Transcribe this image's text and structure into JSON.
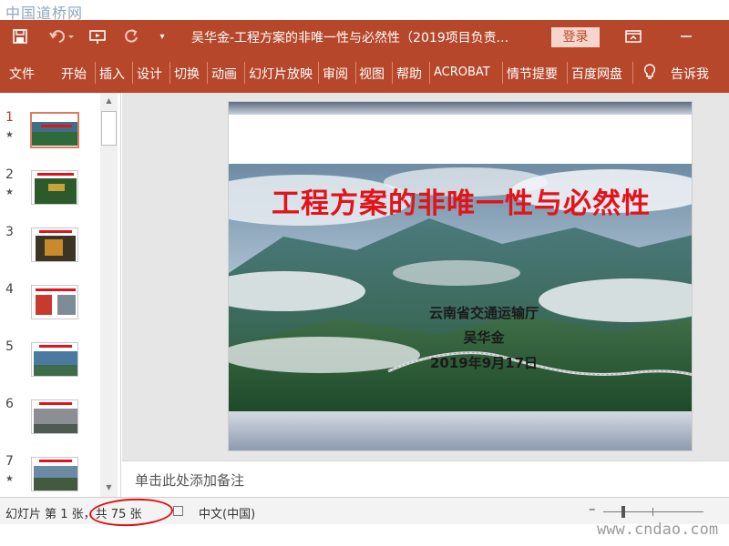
{
  "watermark": {
    "top": "中国道桥网",
    "bottom": "www.cndao.com"
  },
  "titlebar": {
    "title": "吴华金-工程方案的非唯一性与必然性（2019项目负责...",
    "login_label": "登录",
    "icons": [
      "save-icon",
      "undo-icon",
      "present-from-start-icon",
      "redo-icon",
      "customize-toolbar-icon",
      "ribbon-display-options-icon",
      "minimize-icon"
    ]
  },
  "ribbon": {
    "tabs": [
      "文件",
      "开始",
      "插入",
      "设计",
      "切换",
      "动画",
      "幻灯片放映",
      "审阅",
      "视图",
      "帮助",
      "ACROBAT",
      "情节提要",
      "百度网盘"
    ],
    "tell_me": "告诉我"
  },
  "thumbnails": {
    "slides": [
      {
        "num": "1",
        "star": true,
        "active": true
      },
      {
        "num": "2",
        "star": true,
        "active": false
      },
      {
        "num": "3",
        "star": false,
        "active": false
      },
      {
        "num": "4",
        "star": false,
        "active": false
      },
      {
        "num": "5",
        "star": false,
        "active": false
      },
      {
        "num": "6",
        "star": false,
        "active": false
      },
      {
        "num": "7",
        "star": true,
        "active": false
      }
    ]
  },
  "slide": {
    "title": "工程方案的非唯一性与必然性",
    "org": "云南省交通运输厅",
    "author": "吴华金",
    "date": "2019年9月17日"
  },
  "notes": {
    "placeholder": "单击此处添加备注"
  },
  "status": {
    "slide_info_prefix": "幻灯片 第 1 张，",
    "slide_info_total": "共 75 张",
    "language": "中文(中国)",
    "zoom_minus": "–"
  },
  "colors": {
    "accent": "#b7472a",
    "title_red": "#e3131b",
    "annotation_circle": "#dd1111"
  }
}
